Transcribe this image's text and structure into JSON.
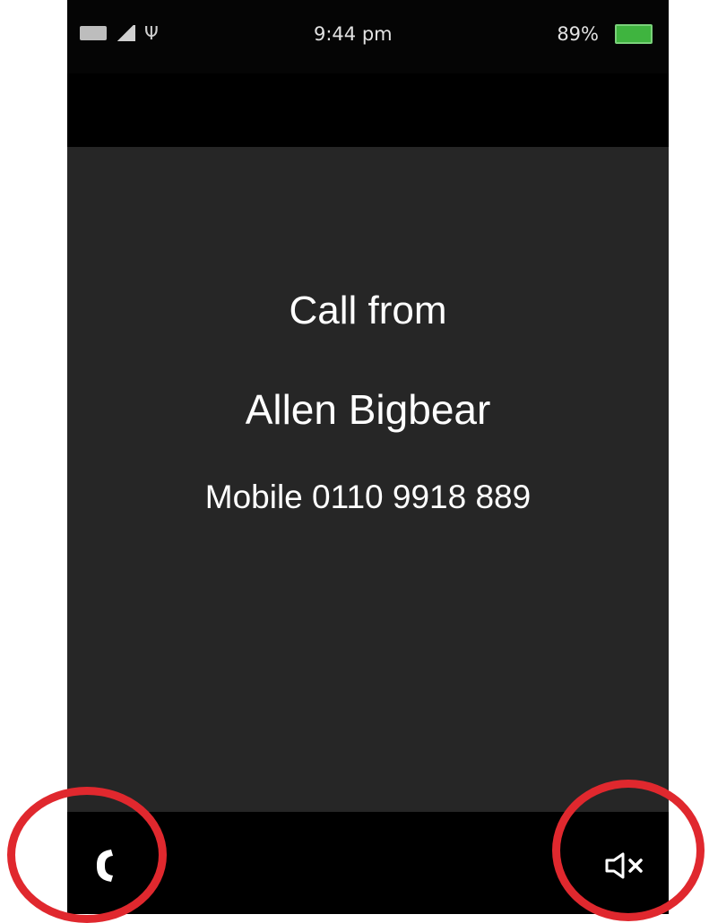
{
  "status_bar": {
    "time": "9:44 pm",
    "battery_percent": "89%",
    "battery_color": "#3fb43f",
    "icons": [
      "network-badge-icon",
      "signal-icon",
      "usb-icon",
      "battery-icon"
    ]
  },
  "call": {
    "heading": "Call from",
    "caller_name": "Allen Bigbear",
    "caller_number": "Mobile 0110 9918 889"
  },
  "softkeys": {
    "left_icon": "answer-call-icon",
    "right_icon": "mute-speaker-icon"
  },
  "annotations": {
    "highlight_color": "#e0282e"
  }
}
